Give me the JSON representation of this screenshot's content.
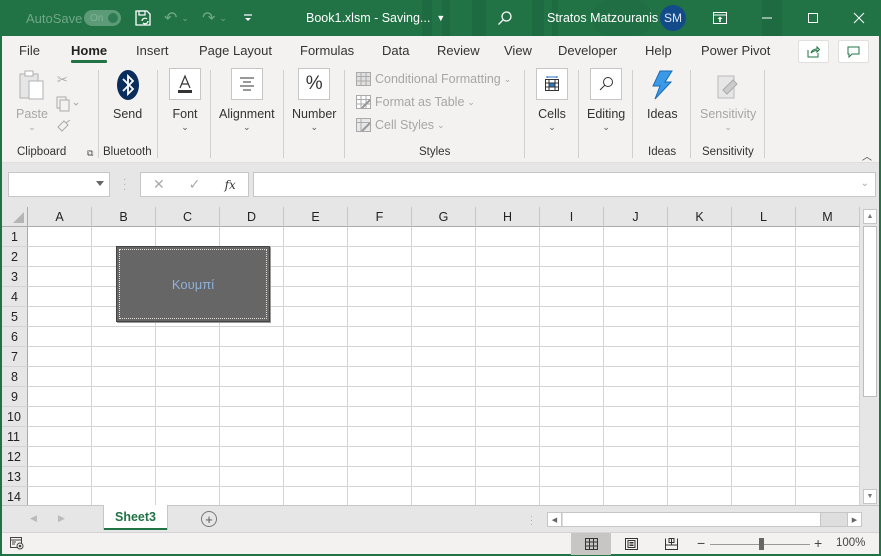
{
  "titlebar": {
    "autosave_label": "AutoSave",
    "autosave_state": "On",
    "doc_title": "Book1.xlsm  -  Saving...",
    "user_name": "Stratos Matzouranis",
    "user_initials": "SM",
    "icons": [
      "save-icon",
      "undo-icon",
      "redo-icon",
      "customize-qat-icon",
      "search-icon",
      "ribbon-display-icon",
      "minimize-icon",
      "maximize-icon",
      "close-icon"
    ]
  },
  "tabs": [
    {
      "label": "File",
      "active": false
    },
    {
      "label": "Home",
      "active": true
    },
    {
      "label": "Insert",
      "active": false
    },
    {
      "label": "Page Layout",
      "active": false
    },
    {
      "label": "Formulas",
      "active": false
    },
    {
      "label": "Data",
      "active": false
    },
    {
      "label": "Review",
      "active": false
    },
    {
      "label": "View",
      "active": false
    },
    {
      "label": "Developer",
      "active": false
    },
    {
      "label": "Help",
      "active": false
    },
    {
      "label": "Power Pivot",
      "active": false
    }
  ],
  "ribbon": {
    "clipboard": {
      "paste": "Paste",
      "group": "Clipboard"
    },
    "bluetooth": {
      "send": "Send",
      "group": "Bluetooth"
    },
    "font": "Font",
    "alignment": "Alignment",
    "number": "Number",
    "styles": {
      "conditional_formatting": "Conditional Formatting",
      "format_as_table": "Format as Table",
      "cell_styles": "Cell Styles",
      "group": "Styles"
    },
    "cells": "Cells",
    "editing": "Editing",
    "ideas": {
      "button": "Ideas",
      "group": "Ideas"
    },
    "sensitivity": {
      "button": "Sensitivity",
      "group": "Sensitivity"
    }
  },
  "formula_bar": {
    "name_box": "",
    "formula": "",
    "cancel": "✕",
    "enter": "✓",
    "fx": "fx"
  },
  "grid": {
    "columns": [
      "A",
      "B",
      "C",
      "D",
      "E",
      "F",
      "G",
      "H",
      "I",
      "J",
      "K",
      "L",
      "M"
    ],
    "rows": [
      "1",
      "2",
      "3",
      "4",
      "5",
      "6",
      "7",
      "8",
      "9",
      "10",
      "11",
      "12",
      "13",
      "14"
    ]
  },
  "form_button": {
    "caption": "Κουμπί"
  },
  "sheets": [
    {
      "name": "Sheet3",
      "active": true
    }
  ],
  "statusbar": {
    "views": [
      "normal-view",
      "page-layout-view",
      "page-break-preview"
    ],
    "active_view": "normal-view",
    "zoom_minus": "−",
    "zoom_plus": "+",
    "zoom_level": "100%"
  }
}
